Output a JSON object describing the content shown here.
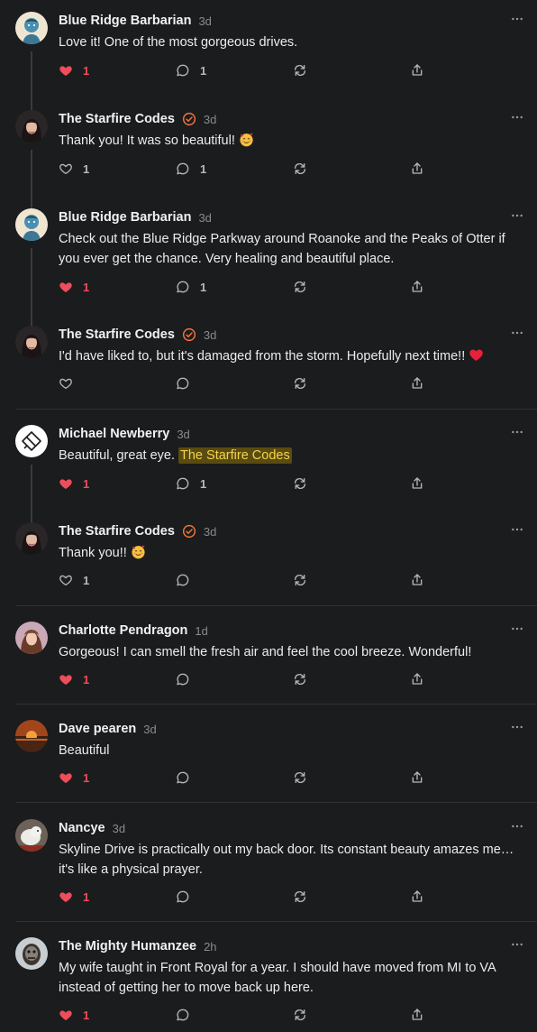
{
  "colors": {
    "background": "#1b1c1e",
    "liked": "#ef4d5b",
    "verified": "#f2733a",
    "mention_bg": "#5a4b10",
    "mention_text": "#f3d44a"
  },
  "comments": [
    {
      "author": "Blue Ridge Barbarian",
      "time": "3d",
      "verified": false,
      "avatar_icon": "blue-character-avatar",
      "text": "Love it! One of the most gorgeous drives.",
      "likes": "1",
      "liked": true,
      "replies": "1"
    },
    {
      "author": "The Starfire Codes",
      "time": "3d",
      "verified": true,
      "avatar_icon": "woman-portrait-avatar",
      "text": "Thank you! It was so beautiful!",
      "emoji": "smiling-face-with-hearts-emoji",
      "likes": "1",
      "liked": false,
      "replies": "1"
    },
    {
      "author": "Blue Ridge Barbarian",
      "time": "3d",
      "verified": false,
      "avatar_icon": "blue-character-avatar",
      "text_line1": "Check out the Blue Ridge Parkway around Roanoke and the Peaks of Otter if",
      "text_line2": "you ever get the chance. Very healing and beautiful place.",
      "likes": "1",
      "liked": true,
      "replies": "1"
    },
    {
      "author": "The Starfire Codes",
      "time": "3d",
      "verified": true,
      "avatar_icon": "woman-portrait-avatar",
      "text": "I'd have liked to, but it's damaged from the storm. Hopefully next time!!",
      "emoji": "red-heart-emoji",
      "likes": "",
      "liked": false,
      "replies": ""
    },
    {
      "author": "Michael Newberry",
      "time": "3d",
      "verified": false,
      "avatar_icon": "logo-avatar",
      "text": "Beautiful, great eye.",
      "mention": "The Starfire Codes",
      "likes": "1",
      "liked": true,
      "replies": "1"
    },
    {
      "author": "The Starfire Codes",
      "time": "3d",
      "verified": true,
      "avatar_icon": "woman-portrait-avatar",
      "text": "Thank you!!",
      "emoji": "smiling-face-with-hearts-emoji",
      "likes": "1",
      "liked": false,
      "replies": ""
    },
    {
      "author": "Charlotte Pendragon",
      "time": "1d",
      "verified": false,
      "avatar_icon": "woman-portrait-avatar",
      "text": "Gorgeous! I can smell the fresh air and feel the cool breeze. Wonderful!",
      "likes": "1",
      "liked": true,
      "replies": ""
    },
    {
      "author": "Dave pearen",
      "time": "3d",
      "verified": false,
      "avatar_icon": "sunset-photo-avatar",
      "text": "Beautiful",
      "likes": "1",
      "liked": true,
      "replies": ""
    },
    {
      "author": "Nancye",
      "time": "3d",
      "verified": false,
      "avatar_icon": "dog-photo-avatar",
      "text_line1": "Skyline Drive is practically out my back door. Its constant beauty amazes me…",
      "text_line2": "it's like a physical prayer.",
      "likes": "1",
      "liked": true,
      "replies": ""
    },
    {
      "author": "The Mighty Humanzee",
      "time": "2h",
      "verified": false,
      "avatar_icon": "mask-avatar",
      "text_line1": "My wife taught in Front Royal for a year. I should have moved from MI to VA",
      "text_line2": "instead of getting her to move back up here.",
      "likes": "1",
      "liked": true,
      "replies": ""
    }
  ]
}
